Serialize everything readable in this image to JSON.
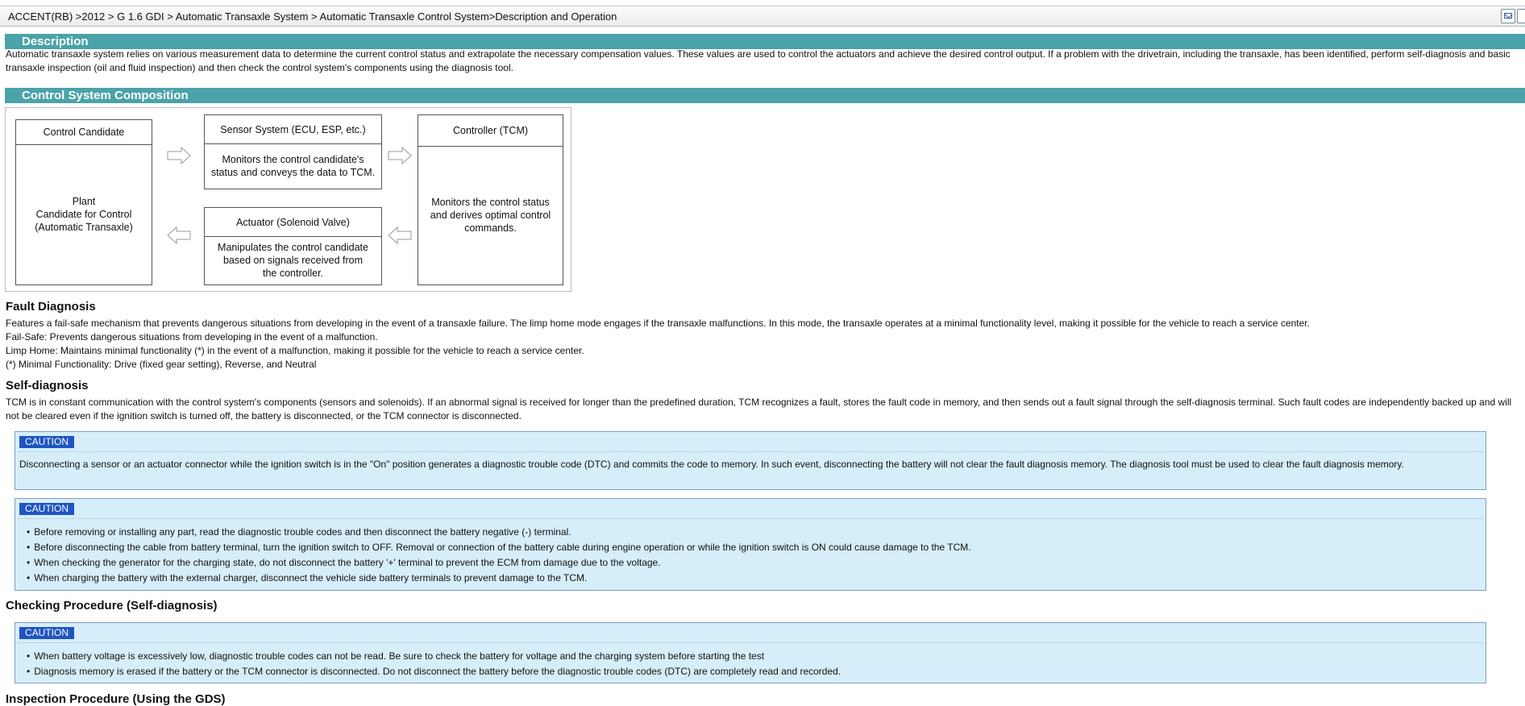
{
  "breadcrumb": {
    "text": "ACCENT(RB) >2012 > G 1.6 GDI > Automatic Transaxle System > Automatic Transaxle Control System>Description and Operation",
    "mail_icon": "mail-icon",
    "copy_icon": "window-icon"
  },
  "description": {
    "header": "Description",
    "text": "Automatic transaxle system relies on various measurement data to determine the current control status and extrapolate the necessary compensation values. These values are used to control the actuators and achieve the desired control output. If a problem with the drivetrain, including the transaxle, has been identified, perform self-diagnosis and basic transaxle inspection (oil and fluid inspection) and then check the control system's components using the diagnosis tool."
  },
  "composition": {
    "header": "Control System Composition",
    "diagram": {
      "candidate_title": "Control Candidate",
      "candidate_body_1": "Plant",
      "candidate_body_2": "Candidate for Control",
      "candidate_body_3": "(Automatic Transaxle)",
      "sensor_title": "Sensor System (ECU, ESP, etc.)",
      "sensor_body_1": "Monitors the control candidate's",
      "sensor_body_2": "status and conveys the data to TCM.",
      "controller_title": "Controller (TCM)",
      "controller_body_1": "Monitors the control status",
      "controller_body_2": "and derives optimal control",
      "controller_body_3": "commands.",
      "actuator_title": "Actuator (Solenoid Valve)",
      "actuator_body_1": "Manipulates the control candidate",
      "actuator_body_2": "based on signals received from",
      "actuator_body_3": "the controller."
    }
  },
  "fault": {
    "title": "Fault Diagnosis",
    "line1": "Features a fail-safe mechanism that prevents dangerous situations from developing in the event of a transaxle failure. The limp home mode engages if the transaxle malfunctions. In this mode, the transaxle operates at a minimal functionality level, making it possible for the vehicle to reach a service center.",
    "line2": "Fail-Safe: Prevents dangerous situations from developing in the event of a malfunction.",
    "line3": "Limp Home: Maintains minimal functionality (*) in the event of a malfunction, making it possible for the vehicle to reach a service center.",
    "line4": "(*) Minimal Functionality: Drive (fixed gear setting), Reverse, and Neutral"
  },
  "self_diag": {
    "title": "Self-diagnosis",
    "text": "TCM is in constant communication with the control system's components (sensors and solenoids). If an abnormal signal is received for longer than the predefined duration, TCM recognizes a fault, stores the fault code in memory, and then sends out a fault signal through the self-diagnosis terminal. Such fault codes are independently backed up and will not be cleared even if the ignition switch is turned off, the battery is disconnected, or the TCM connector is disconnected."
  },
  "caution1": {
    "badge": "CAUTION",
    "text": "Disconnecting a sensor or an actuator connector while the ignition switch is in the \"On\" position generates a diagnostic trouble code (DTC) and commits the code to memory. In such event, disconnecting the battery will not clear the fault diagnosis memory. The diagnosis tool must be used to clear the fault diagnosis memory."
  },
  "caution2": {
    "badge": "CAUTION",
    "items": [
      "Before removing or installing any part, read the diagnostic trouble codes and then disconnect the battery negative (-) terminal.",
      "Before disconnecting the cable from battery terminal, turn the ignition switch to OFF. Removal or connection of the battery cable during engine operation or while the ignition switch is ON could cause damage to the TCM.",
      "When checking the generator for the charging state, do not disconnect the battery '+' terminal to prevent the ECM from damage due to the voltage.",
      "When charging the battery with the external charger, disconnect the vehicle side battery terminals to prevent damage to the TCM."
    ]
  },
  "checking": {
    "title": "Checking Procedure (Self-diagnosis)"
  },
  "caution3": {
    "badge": "CAUTION",
    "items": [
      "When battery voltage is excessively low, diagnostic trouble codes can not be read. Be sure to check the battery for voltage and the charging system before starting the test",
      "Diagnosis memory is erased if the battery or the TCM connector is disconnected. Do not disconnect the battery before the diagnostic trouble codes (DTC) are completely read and recorded."
    ]
  },
  "inspection": {
    "title": "Inspection Procedure (Using the GDS)"
  }
}
